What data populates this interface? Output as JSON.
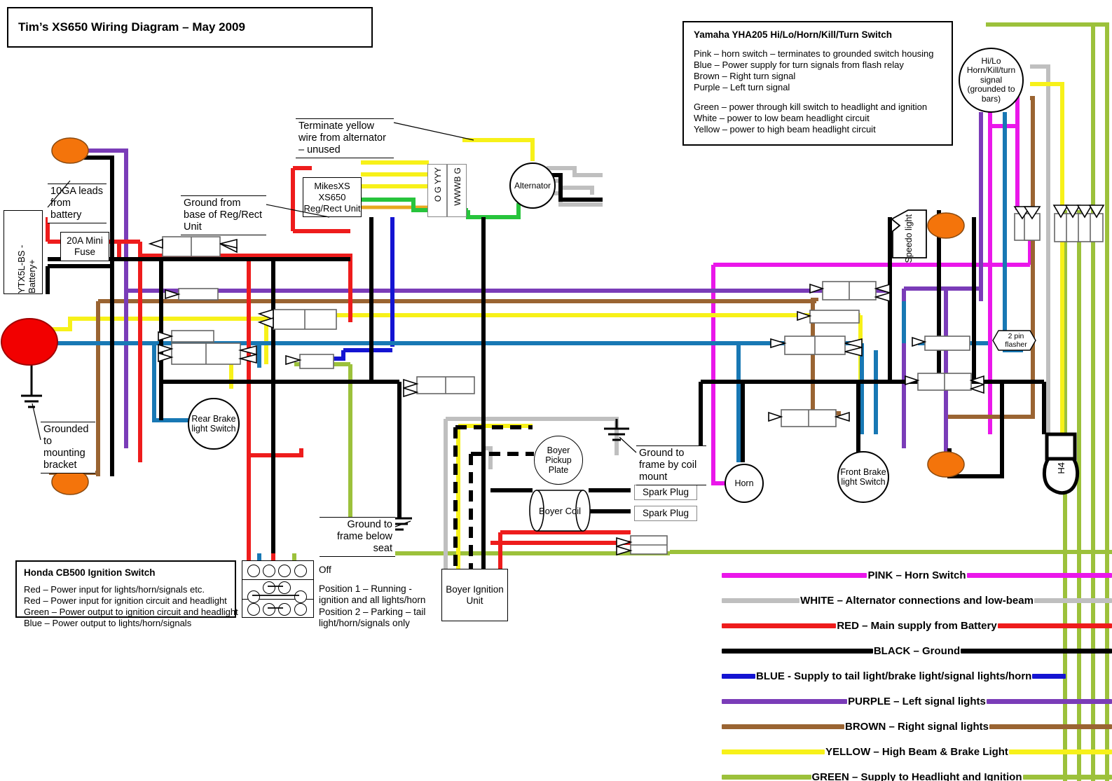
{
  "title": "Tim’s XS650 Wiring Diagram – May 2009",
  "switch_legend": {
    "heading": "Yamaha YHA205 Hi/Lo/Horn/Kill/Turn Switch",
    "lines_group1": [
      "Pink – horn switch – terminates to grounded switch housing",
      "Blue – Power supply for turn signals from flash relay",
      "Brown – Right turn signal",
      "Purple – Left turn signal"
    ],
    "lines_group2": [
      "Green – power through kill switch to headlight and ignition",
      "White – power to low beam headlight circuit",
      "Yellow – power to high beam headlight circuit"
    ]
  },
  "ignition_legend": {
    "heading": "Honda CB500 Ignition Switch",
    "lines": [
      "Red – Power input for lights/horn/signals etc.",
      "Red – Power input for ignition circuit and headlight",
      "Green – Power output to ignition circuit and headlight",
      "Blue – Power output to lights/horn/signals"
    ]
  },
  "ignition_table": {
    "row_labels": [
      "Off",
      "Position 1 – Running - ignition and all lights/horn",
      "Position 2 – Parking – tail light/horn/signals only"
    ]
  },
  "components": {
    "battery": "YTX5L-BS - Battery+",
    "fuse": "20A Mini Fuse",
    "regrect": "MikesXS XS650 Reg/Rect Unit",
    "alternator": "Alternator",
    "connector_left": "O G YYY",
    "connector_right": "WWWB G",
    "speedo_light": "Speedo light",
    "hilo_switch": "Hi/Lo Horn/Kill/turn signal (grounded to bars)",
    "rear_brake_switch": "Rear Brake light Switch",
    "front_brake_switch": "Front Brake light Switch",
    "horn": "Horn",
    "flasher": "2 pin flasher",
    "h4": "H4",
    "boyer_pickup": "Boyer Pickup Plate",
    "boyer_coil": "Boyer Coil",
    "boyer_unit": "Boyer Ignition Unit",
    "spark_plug_1": "Spark Plug",
    "spark_plug_2": "Spark Plug"
  },
  "callouts": {
    "leads": "10GA leads from battery",
    "ground_regrect": "Ground from base of Reg/Rect Unit",
    "terminate_yellow": "Terminate yellow wire from alternator – unused",
    "grounded_bracket": "Grounded to mounting bracket",
    "ground_below_seat": "Ground to frame below seat",
    "ground_coil_mount": "Ground to frame by coil mount"
  },
  "wire_legend": [
    {
      "name": "pink",
      "label": "PINK – Horn Switch",
      "color": "#ea17ea"
    },
    {
      "name": "white",
      "label": "WHITE – Alternator connections and low-beam",
      "color": "#bfbfbf"
    },
    {
      "name": "red",
      "label": "RED – Main supply from Battery",
      "color": "#ee1c1c"
    },
    {
      "name": "black",
      "label": "BLACK – Ground",
      "color": "#000000"
    },
    {
      "name": "blue",
      "label": "BLUE - Supply to tail light/brake light/signal lights/horn",
      "color": "#1414d2"
    },
    {
      "name": "purple",
      "label": "PURPLE – Left signal lights",
      "color": "#7a3cb8"
    },
    {
      "name": "brown",
      "label": "BROWN – Right signal lights",
      "color": "#9a6432"
    },
    {
      "name": "yellow",
      "label": "YELLOW – High Beam & Brake Light",
      "color": "#f7f119"
    },
    {
      "name": "green",
      "label": "GREEN – Supply to Headlight and Ignition",
      "color": "#9cc13b"
    }
  ],
  "colors": {
    "pink": "#ea17ea",
    "white": "#bfbfbf",
    "red": "#ee1c1c",
    "black": "#000000",
    "blue_dark": "#1414d2",
    "blue_steel": "#1878b4",
    "purple": "#7a3cb8",
    "brown": "#9a6432",
    "yellow": "#f7f119",
    "green": "#9cc13b",
    "green_bright": "#27c43c",
    "orange": "#f4740b",
    "tail_red": "#f20000"
  }
}
